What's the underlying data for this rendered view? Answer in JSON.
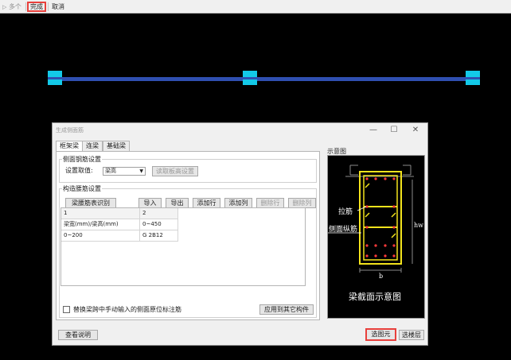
{
  "toolbar": {
    "items": [
      {
        "label": "多个",
        "icon": "multi-select-icon",
        "disabled": true
      },
      {
        "label": "完成"
      },
      {
        "label": "取消"
      }
    ]
  },
  "dialog": {
    "title": "生成侧面筋",
    "tabs": [
      "框架梁",
      "连梁",
      "基础梁"
    ],
    "side_rebar": {
      "group_label": "侧面钢筋设置",
      "setting_label": "设置取值:",
      "setting_value": "梁高",
      "slab_height_button": "读取板高设置"
    },
    "waist_rebar": {
      "group_label": "构造腰筋设置",
      "buttons": {
        "identify": "梁腰筋表识别",
        "import": "导入",
        "export": "导出",
        "add_row": "添加行",
        "add_col": "添加列",
        "delete_row": "删除行",
        "delete_col": "删除列"
      },
      "table": {
        "header": [
          "1",
          "2"
        ],
        "rows": [
          [
            "梁宽(mm)/梁高(mm)",
            "0~450"
          ],
          [
            "0~200",
            "G 2B12"
          ]
        ]
      }
    },
    "replace_checkbox_label": "替换梁跨中手动输入的侧面原位标注筋",
    "apply_button": "应用到其它构件",
    "help_button": "查看说明",
    "select_element_button": "选图元",
    "select_floor_button": "选楼层",
    "preview": {
      "title": "示意图",
      "label_tie": "拉筋",
      "label_side": "侧面纵筋",
      "label_hw": "hw",
      "label_b": "b",
      "caption": "梁截面示意图"
    }
  },
  "colors": {
    "beam": "#2f4fb0",
    "node": "#13c9e8",
    "highlight": "#e8403c",
    "rebar": "#f3e31c",
    "rebar_dot": "#ff3a3a"
  }
}
